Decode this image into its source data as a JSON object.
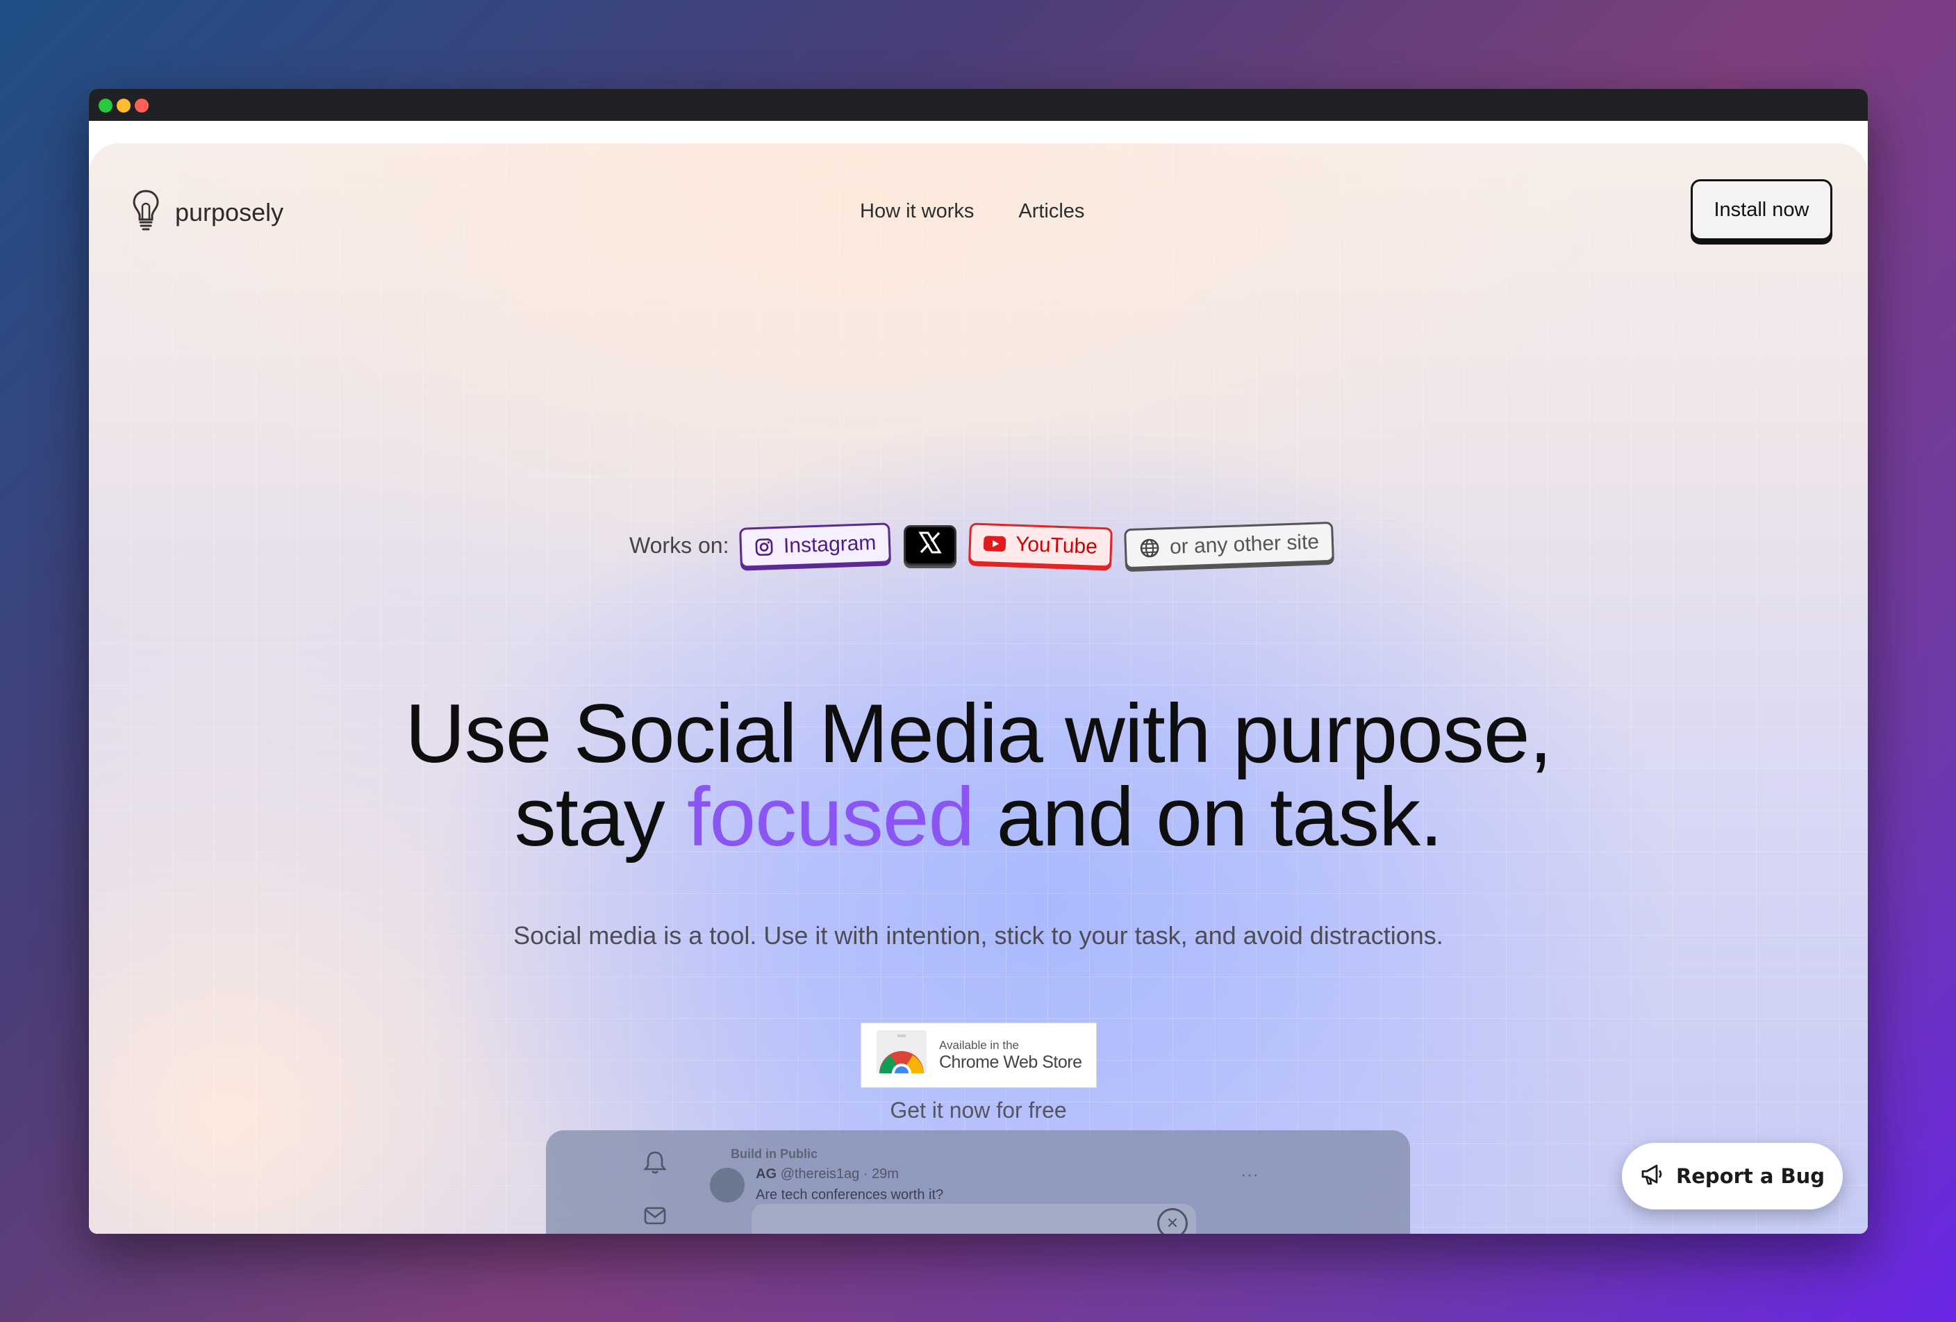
{
  "window": {
    "controls": [
      "close",
      "minimize",
      "zoom"
    ]
  },
  "brand": {
    "name": "purposely",
    "icon": "lightbulb-icon"
  },
  "nav": {
    "items": [
      "How it works",
      "Articles"
    ]
  },
  "header": {
    "install_label": "Install now"
  },
  "hero": {
    "works_on_label": "Works on:",
    "platforms": [
      {
        "label": "Instagram",
        "icon": "instagram-icon",
        "color": "#5b2a92"
      },
      {
        "label": "",
        "icon": "x-logo-icon",
        "color": "#000000"
      },
      {
        "label": "YouTube",
        "icon": "youtube-icon",
        "color": "#e12424"
      },
      {
        "label": "or any other site",
        "icon": "globe-icon",
        "color": "#555555"
      }
    ],
    "headline_line1": "Use Social Media with purpose,",
    "headline_line2_pre": "stay ",
    "headline_accent": "focused",
    "headline_line2_post": " and on task.",
    "accent_color": "#8b55f3",
    "subheadline": "Social media is a tool. Use it with intention, stick to your task, and avoid distractions."
  },
  "cta": {
    "badge_small": "Available in the",
    "badge_big": "Chrome Web Store",
    "caption": "Get it now for free"
  },
  "preview": {
    "group": "Build in Public",
    "author": "AG",
    "handle": "@thereis1ag · 29m",
    "text": "Are tech conferences worth it?"
  },
  "report": {
    "label": "Report a Bug"
  }
}
